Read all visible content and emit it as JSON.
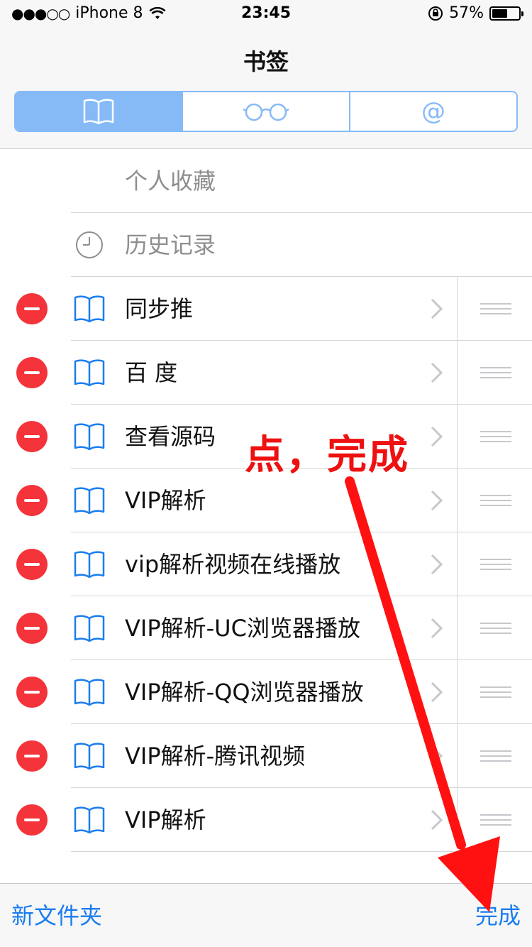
{
  "status_bar": {
    "signal": "●●●○○",
    "carrier": "iPhone 8",
    "time": "23:45",
    "battery_percent": "57%",
    "battery_level": 0.57
  },
  "header": {
    "title": "书签",
    "tabs": [
      {
        "name": "bookmarks",
        "icon": "book-icon",
        "active": true
      },
      {
        "name": "reading-list",
        "icon": "glasses-icon",
        "glyph": "◯‿◯",
        "active": false
      },
      {
        "name": "shared-links",
        "icon": "at-icon",
        "glyph": "@",
        "active": false
      }
    ]
  },
  "list": {
    "special_items": [
      {
        "label": "个人收藏",
        "icon": "none"
      },
      {
        "label": "历史记录",
        "icon": "clock-icon"
      }
    ],
    "bookmarks": [
      {
        "label": "同步推"
      },
      {
        "label": "百 度"
      },
      {
        "label": "查看源码"
      },
      {
        "label": "VIP解析"
      },
      {
        "label": "vip解析视频在线播放"
      },
      {
        "label": "VIP解析-UC浏览器播放"
      },
      {
        "label": "VIP解析-QQ浏览器播放"
      },
      {
        "label": "VIP解析-腾讯视频"
      },
      {
        "label": "VIP解析"
      }
    ]
  },
  "toolbar": {
    "new_folder_label": "新文件夹",
    "done_label": "完成"
  },
  "annotation": {
    "text": "点，完成",
    "color": "#ee1111"
  },
  "colors": {
    "accent": "#1a7df0",
    "segment_blue": "#86baf7",
    "delete_red": "#f4333a"
  }
}
